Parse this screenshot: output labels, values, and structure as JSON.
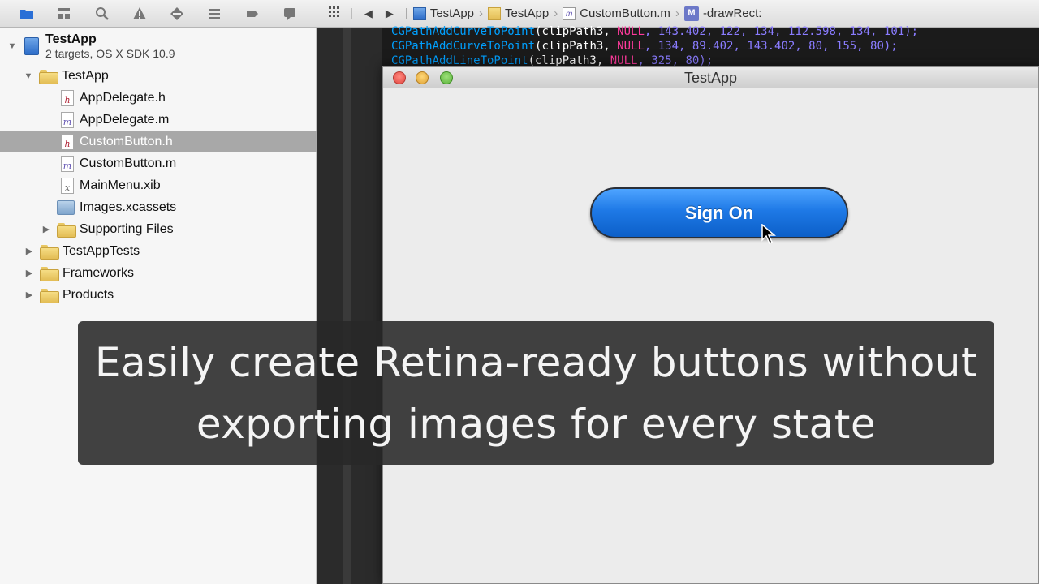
{
  "navigator_toolbar": {
    "icons": [
      "folder-icon",
      "hierarchy-icon",
      "search-icon",
      "warning-icon",
      "test-icon",
      "debug-icon",
      "breakpoint-icon",
      "log-icon"
    ]
  },
  "navigator": {
    "project": {
      "name": "TestApp",
      "subtitle": "2 targets, OS X SDK 10.9"
    },
    "items": [
      {
        "label": "TestApp",
        "type": "folder",
        "expanded": true
      },
      {
        "label": "AppDelegate.h",
        "type": "h"
      },
      {
        "label": "AppDelegate.m",
        "type": "m"
      },
      {
        "label": "CustomButton.h",
        "type": "h",
        "selected": true
      },
      {
        "label": "CustomButton.m",
        "type": "m"
      },
      {
        "label": "MainMenu.xib",
        "type": "xib"
      },
      {
        "label": "Images.xcassets",
        "type": "assets"
      },
      {
        "label": "Supporting Files",
        "type": "folder",
        "expanded": false
      },
      {
        "label": "TestAppTests",
        "type": "folder",
        "expanded": false
      },
      {
        "label": "Frameworks",
        "type": "folder",
        "expanded": false
      },
      {
        "label": "Products",
        "type": "folder",
        "expanded": false
      }
    ]
  },
  "jump_bar": {
    "back": "◀",
    "forward": "▶",
    "crumbs": [
      "TestApp",
      "TestApp",
      "CustomButton.m",
      "-drawRect:"
    ],
    "method_badge": "M"
  },
  "code": {
    "line1": {
      "fn": "CGPathAddCurveToPoint",
      "args": "(clipPath3, ",
      "kw": "NULL",
      "nums": ", 143.402, 122, 134, 112.598, 134, 101);"
    },
    "line2": {
      "fn": "CGPathAddCurveToPoint",
      "args": "(clipPath3, ",
      "kw": "NULL",
      "nums": ", 134, 89.402, 143.402, 80, 155, 80);"
    },
    "line3": {
      "fn": "CGPathAddLineToPoint",
      "args": "(clipPath3, ",
      "kw": "NULL",
      "nums": ", 325, 80);"
    }
  },
  "app_window": {
    "title": "TestApp",
    "button_label": "Sign On"
  },
  "caption": {
    "text": "Easily create Retina-ready buttons without exporting images for every state"
  },
  "colors": {
    "button_blue": "#1e79e6",
    "caption_bg": "#282828",
    "selection_gray": "#a8a8a8"
  }
}
